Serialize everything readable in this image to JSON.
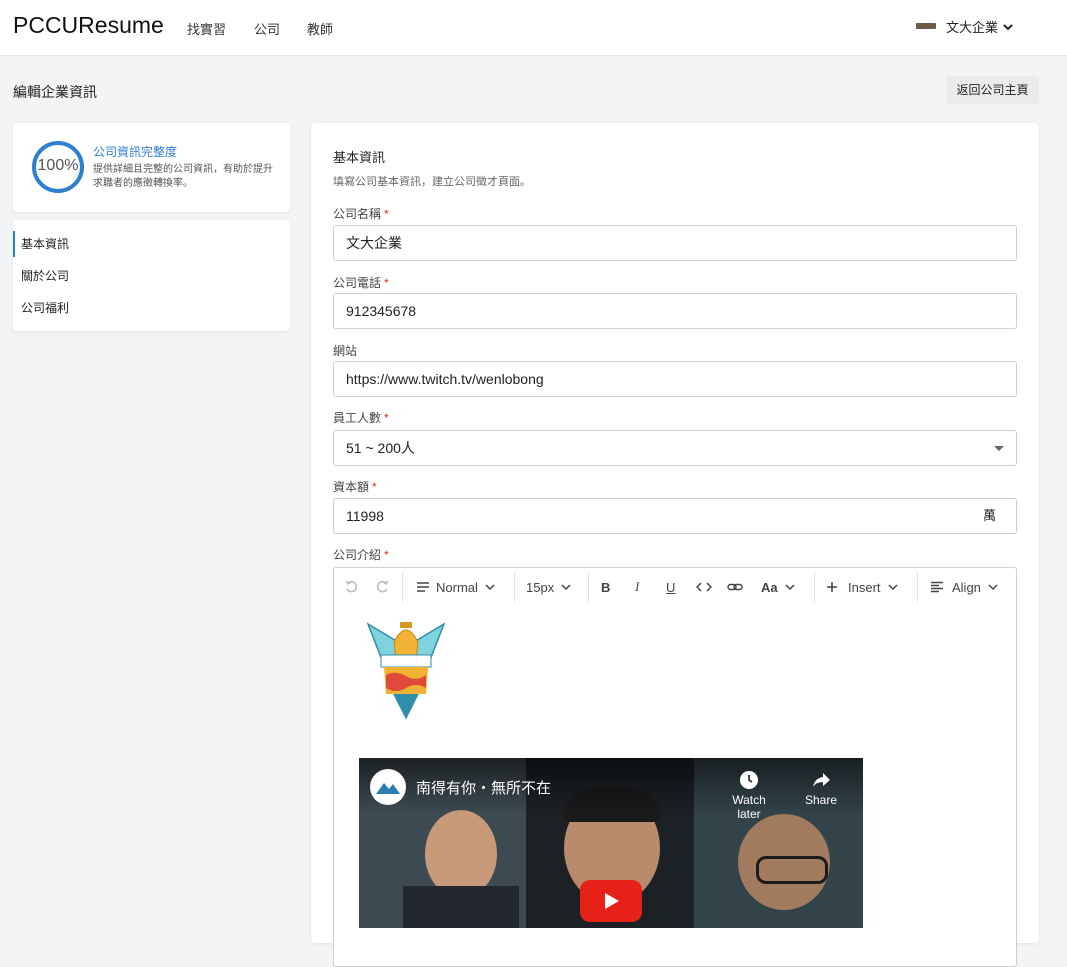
{
  "nav": {
    "brand": "PCCUResume",
    "links": [
      "找實習",
      "公司",
      "教師"
    ],
    "user_name": "文大企業"
  },
  "page": {
    "title": "編輯企業資訊",
    "back_button": "返回公司主頁"
  },
  "progress": {
    "percent_text": "100%",
    "percent": 100,
    "title": "公司資訊完整度",
    "description": "提供詳細且完整的公司資訊，有助於提升求職者的應徵轉換率。"
  },
  "side_menu": {
    "items": [
      {
        "label": "基本資訊",
        "active": true
      },
      {
        "label": "關於公司",
        "active": false
      },
      {
        "label": "公司福利",
        "active": false
      }
    ]
  },
  "form": {
    "section_title": "基本資訊",
    "section_desc": "填寫公司基本資訊，建立公司徵才頁面。",
    "company_name": {
      "label": "公司名稱",
      "required": "*",
      "value": "文大企業"
    },
    "phone": {
      "label": "公司電話",
      "required": "*",
      "value": "912345678"
    },
    "website": {
      "label": "網站",
      "value": "https://www.twitch.tv/wenlobong"
    },
    "employees": {
      "label": "員工人數",
      "required": "*",
      "value": "51 ~ 200人"
    },
    "capital": {
      "label": "資本額",
      "required": "*",
      "value": "11998",
      "suffix": "萬"
    },
    "intro": {
      "label": "公司介紹",
      "required": "*"
    }
  },
  "editor": {
    "toolbar": {
      "block_style": "Normal",
      "font_size": "15px",
      "bold": "B",
      "italic": "I",
      "underline": "U",
      "font_case": "Aa",
      "insert": "Insert",
      "align": "Align"
    },
    "video": {
      "title": "南得有你・無所不在",
      "watch_later": "Watch later",
      "share": "Share"
    }
  },
  "colors": {
    "accent": "#2f7fd1",
    "required": "#d93025",
    "youtube_red": "#e62117"
  }
}
